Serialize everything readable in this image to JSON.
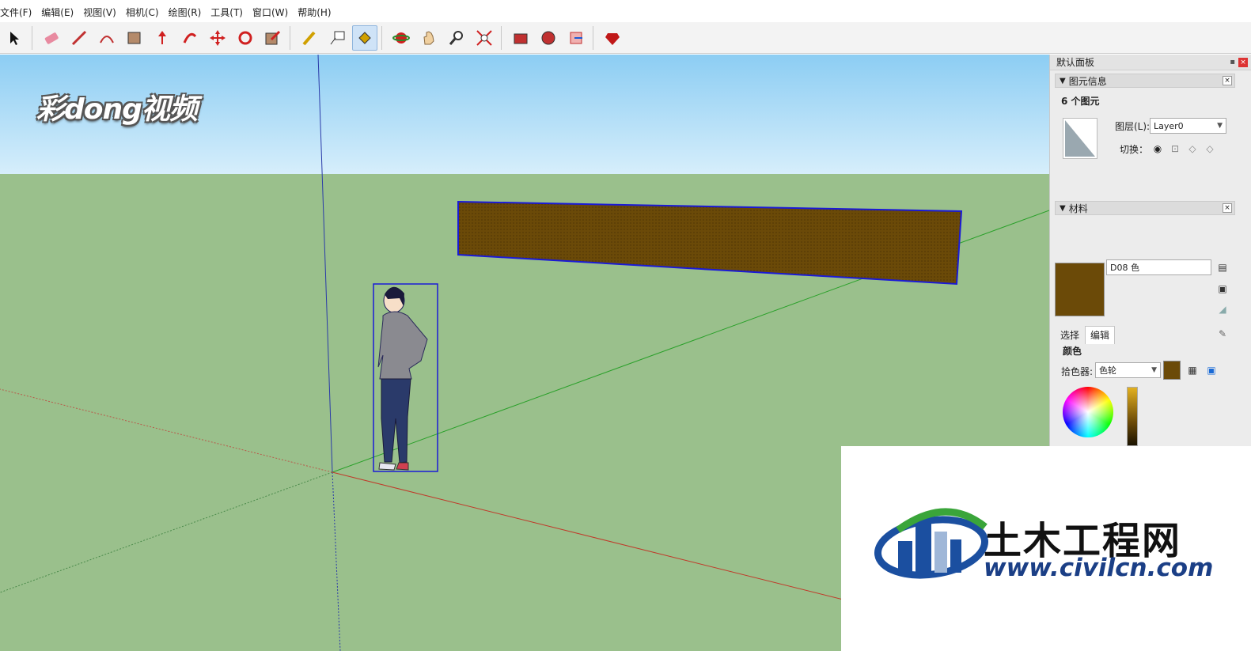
{
  "menu": {
    "items": [
      "文件(F)",
      "编辑(E)",
      "视图(V)",
      "相机(C)",
      "绘图(R)",
      "工具(T)",
      "窗口(W)",
      "帮助(H)"
    ]
  },
  "toolbar": {
    "tools": [
      {
        "name": "select-tool-icon"
      },
      {
        "name": "eraser-tool-icon"
      },
      {
        "name": "pencil-tool-icon"
      },
      {
        "name": "arc-tool-icon"
      },
      {
        "name": "rectangle-tool-icon"
      },
      {
        "name": "push-pull-tool-icon"
      },
      {
        "name": "follow-me-tool-icon"
      },
      {
        "name": "move-tool-icon"
      },
      {
        "name": "rotate-tool-icon"
      },
      {
        "name": "scale-tool-icon"
      },
      {
        "name": "tape-measure-tool-icon"
      },
      {
        "name": "text-tool-icon"
      },
      {
        "name": "paint-bucket-tool-icon"
      },
      {
        "name": "orbit-tool-icon"
      },
      {
        "name": "pan-tool-icon"
      },
      {
        "name": "zoom-tool-icon"
      },
      {
        "name": "zoom-extents-tool-icon"
      },
      {
        "name": "warehouse-icon"
      },
      {
        "name": "extension-warehouse-icon"
      },
      {
        "name": "share-model-icon"
      },
      {
        "name": "ruby-console-icon"
      }
    ],
    "active_tool": "paint-bucket-tool-icon"
  },
  "watermark_top": "彩dong视频",
  "panel": {
    "title": "默认面板",
    "entity_info": {
      "header": "图元信息",
      "count": "6 个图元",
      "layer_label": "图层(L):",
      "layer_value": "Layer0",
      "toggle_label": "切换："
    },
    "materials": {
      "header": "材料",
      "name": "D08 色",
      "tabs": [
        "选择",
        "编辑"
      ],
      "active_tab": "编辑",
      "color_label": "颜色",
      "picker_label": "拾色器:",
      "picker_value": "色轮",
      "swatch_color": "#6b4a08"
    }
  },
  "scene": {
    "sky_color": "#a9d8f5",
    "ground_color": "#9ac08c",
    "box_color": "#6b4a08",
    "selection_color": "#1a1ad6"
  },
  "logo": {
    "cn": "土木工程网",
    "url": "www.civilcn.com"
  }
}
